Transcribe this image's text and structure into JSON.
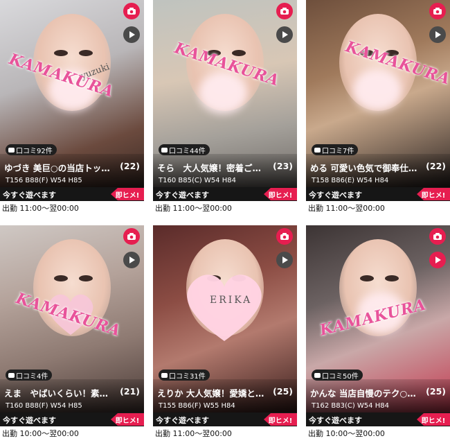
{
  "watermark": "KAMAKURA",
  "cards": [
    {
      "reviews": "口コミ92件",
      "name": "ゆづき",
      "catch": "美巨○の当店トッ…",
      "age": "(22)",
      "stats": "T156 B88(F) W54 H85",
      "available": "今すぐ遊べます",
      "badge": "即ヒメ!",
      "shift": "出勤 11:00〜翌00:00",
      "signature": "yuzuki"
    },
    {
      "reviews": "口コミ44件",
      "name": "そら",
      "catch": "大人気嬢！密着ご…",
      "age": "(23)",
      "stats": "T160 B85(C) W54 H84",
      "available": "今すぐ遊べます",
      "badge": "即ヒメ!",
      "shift": "出勤 11:00〜翌00:00"
    },
    {
      "reviews": "口コミ7件",
      "name": "める",
      "catch": "可愛い色気で御奉仕…",
      "age": "(22)",
      "stats": "T158 B86(E) W54 H84",
      "available": "今すぐ遊べます",
      "badge": "即ヒメ!",
      "shift": "出勤 11:00〜翌00:00"
    },
    {
      "reviews": "口コミ4件",
      "name": "えま",
      "catch": "やばいくらい！素…",
      "age": "(21)",
      "stats": "T160 B88(F) W54 H85",
      "available": "今すぐ遊べます",
      "badge": "即ヒメ!",
      "shift": "出勤 10:00〜翌00:00"
    },
    {
      "reviews": "口コミ31件",
      "name": "えりか",
      "catch": "大人気嬢！愛嬌と…",
      "age": "(25)",
      "stats": "T155 B86(F) W55 H84",
      "available": "今すぐ遊べます",
      "badge": "即ヒメ!",
      "shift": "出勤 11:00〜翌00:00",
      "signature": "ERIKA"
    },
    {
      "reviews": "口コミ50件",
      "name": "かんな",
      "catch": "当店自慢のテク○…",
      "age": "(25)",
      "stats": "T162 B83(C) W54 H84",
      "available": "今すぐ遊べます",
      "badge": "即ヒメ!",
      "shift": "出勤 10:00〜翌00:00"
    }
  ],
  "icons": {
    "camera": "camera-icon",
    "play": "play-icon",
    "h": "h"
  },
  "colors": {
    "accent": "#e61e50",
    "watermark": "#e8539a"
  }
}
